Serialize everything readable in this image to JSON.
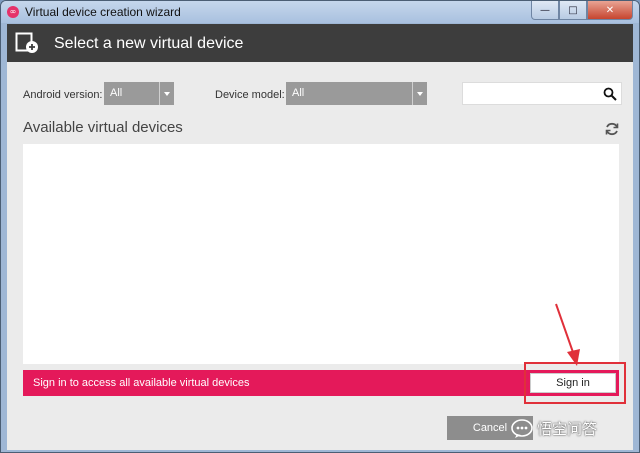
{
  "window": {
    "title": "Virtual device creation wizard",
    "icon": "genymotion-logo-icon",
    "controls": {
      "minimize": "—",
      "maximize": "□",
      "close": "✕"
    }
  },
  "header": {
    "title": "Select a new virtual device",
    "icon": "add-device-icon"
  },
  "filters": {
    "android_version_label": "Android version:",
    "android_version_value": "All",
    "device_model_label": "Device model:",
    "device_model_value": "All",
    "search_placeholder": ""
  },
  "devices": {
    "title": "Available virtual devices",
    "items": []
  },
  "signin": {
    "message": "Sign in to access all available virtual devices",
    "button_label": "Sign in"
  },
  "footer": {
    "cancel_label": "Cancel"
  },
  "watermark": {
    "text": "悟空问答"
  },
  "colors": {
    "accent": "#e4195a",
    "header_bg": "#3d3d3d",
    "dropdown_bg": "#9a9a9a",
    "annotation": "#e0303a"
  }
}
